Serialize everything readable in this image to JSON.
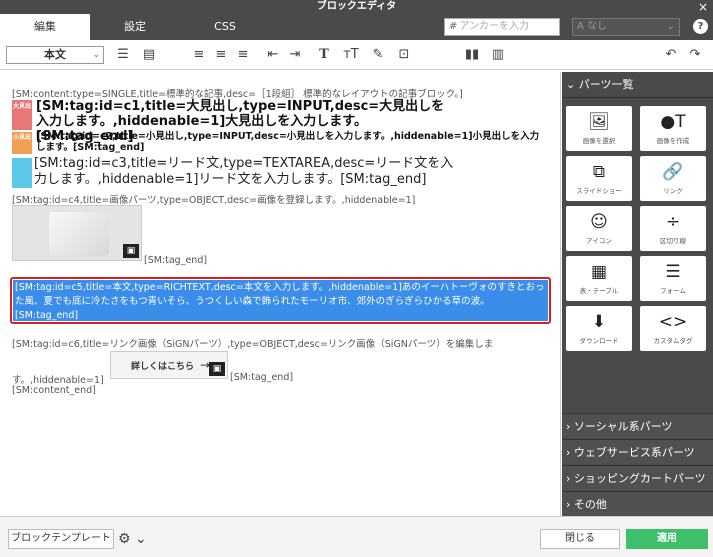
{
  "window": {
    "title": "ブロックエディタ",
    "close": "×"
  },
  "tabs": [
    "編集",
    "設定",
    "CSS"
  ],
  "anchor": {
    "prefix": "#",
    "placeholder": "アンカーを入力"
  },
  "class_select": {
    "value": "なし",
    "prefix": "A"
  },
  "toolbar": {
    "format": "本文",
    "undo": "↶",
    "redo": "↷"
  },
  "editor": {
    "line1": "[SM:content:type=SINGLE,title=標準的な記事,desc=［1段組］ 標準的なレイアウトの記事ブロック。]",
    "badge_big": "大見出",
    "big_heading": "[SM:tag:id=c1,title=大見出し,type=INPUT,desc=大見出しを入力します。,hiddenable=1]大見出しを入力します。[SM:tag_end]",
    "badge_small": "小見出",
    "small_heading": "[SM:tag:id=c2,title=小見出し,type=INPUT,desc=小見出しを入力します。,hiddenable=1]小見出しを入力します。[SM:tag_end]",
    "lead": "[SM:tag:id=c3,title=リード文,type=TEXTAREA,desc=リード文を入力します。,hiddenable=1]リード文を入力します。[SM:tag_end]",
    "image_tag": "[SM:tag:id=c4,title=画像パーツ,type=OBJECT,desc=画像を登録します。,hiddenable=1]",
    "image_end": "[SM:tag_end]",
    "selected_text": "[SM:tag:id=c5,title=本文,type=RICHTEXT,desc=本文を入力します。,hiddenable=1]あのイーハトーヴォのすきとおった風、夏でも底に冷たさをもつ青いそら、うつくしい森で飾られたモーリオ市、郊外のぎらぎらひかる草の波。[SM:tag_end]",
    "link_tag": "[SM:tag:id=c6,title=リンク画像（SiGNパーツ）,type=OBJECT,desc=リンク画像（SiGNパーツ）を編集しま",
    "link_tag2": "す。,hiddenable=1]",
    "link_button": "詳しくはこちら",
    "link_end": "[SM:tag_end]",
    "content_end": "[SM:content_end]"
  },
  "panel": {
    "title": "パーツ一覧",
    "parts": [
      {
        "icon": "image-icon",
        "glyph": "🖼",
        "label": "画像を選択"
      },
      {
        "icon": "create-image-icon",
        "glyph": "●T",
        "label": "画像を作成"
      },
      {
        "icon": "slideshow-icon",
        "glyph": "⧉",
        "label": "スライドショー"
      },
      {
        "icon": "link-icon",
        "glyph": "🔗",
        "label": "リンク"
      },
      {
        "icon": "smile-icon",
        "glyph": "☺",
        "label": "アイコン"
      },
      {
        "icon": "divider-icon",
        "glyph": "÷",
        "label": "区切り線"
      },
      {
        "icon": "table-icon",
        "glyph": "▦",
        "label": "表・テーブル"
      },
      {
        "icon": "form-icon",
        "glyph": "☰",
        "label": "フォーム"
      },
      {
        "icon": "download-icon",
        "glyph": "⬇",
        "label": "ダウンロード"
      },
      {
        "icon": "code-icon",
        "glyph": "<>",
        "label": "カスタムタグ"
      }
    ],
    "categories": [
      "ソーシャル系パーツ",
      "ウェブサービス系パーツ",
      "ショッピングカートパーツ",
      "その他"
    ]
  },
  "footer": {
    "template": "ブロックテンプレート",
    "close": "閉じる",
    "apply": "適用"
  }
}
